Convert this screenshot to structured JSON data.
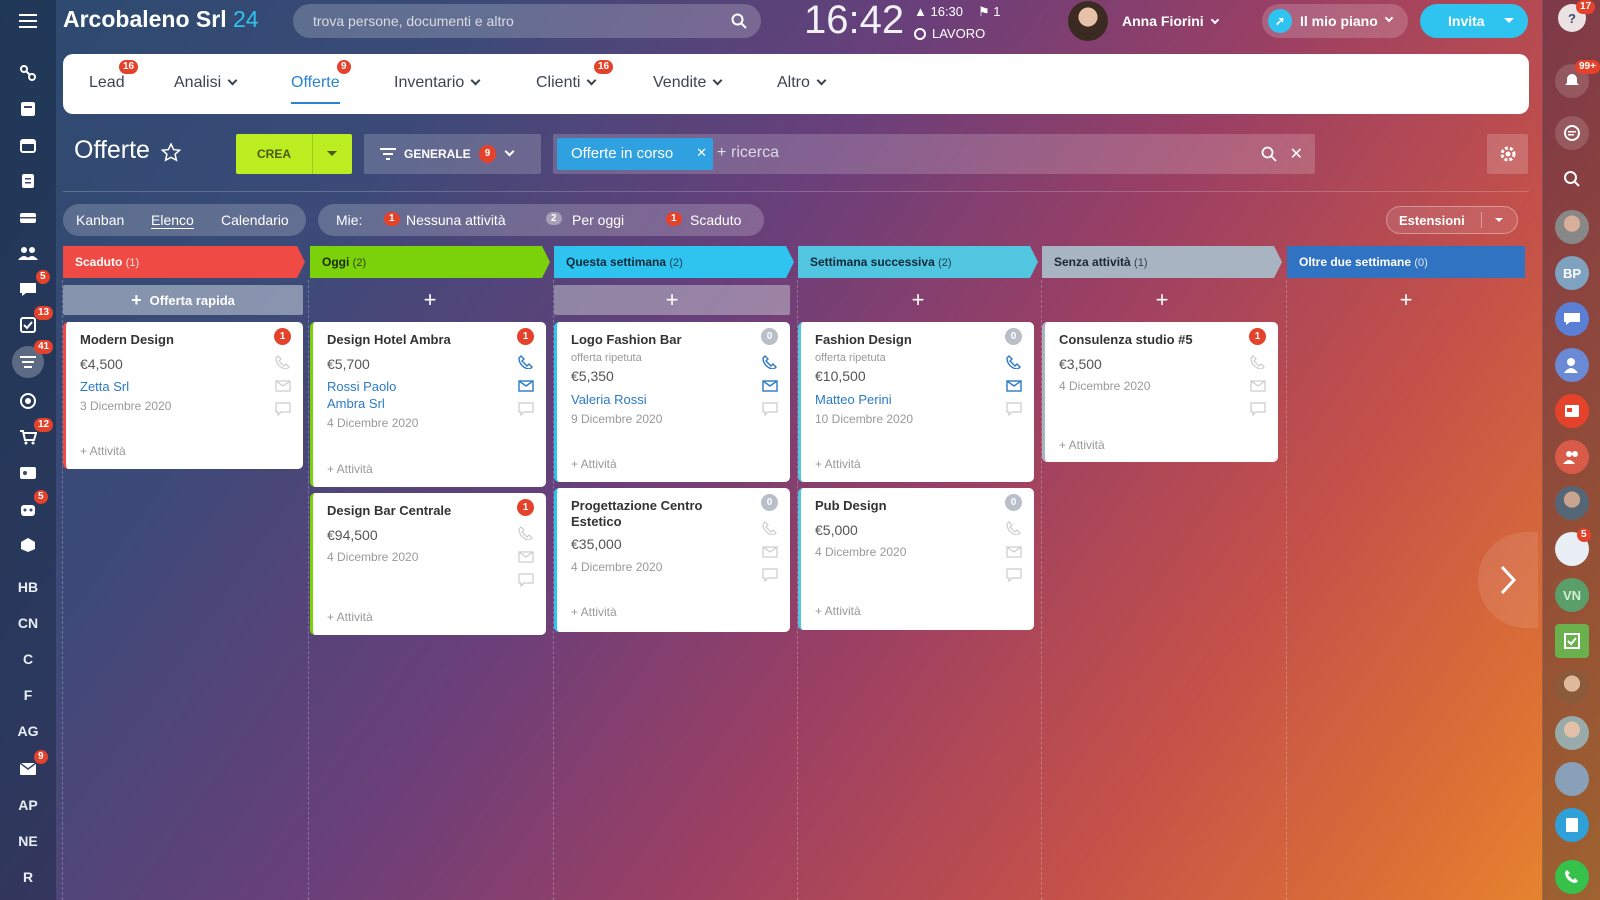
{
  "app": {
    "brand": "Arcobaleno Srl",
    "brand_num": "24",
    "search_placeholder": "trova persone, documenti e altro",
    "clock": "16:42",
    "alarm": "16:30",
    "flag_count": "1",
    "work_status": "LAVORO",
    "user_name": "Anna Fiorini",
    "plan_label": "Il mio piano",
    "invite_label": "Invita",
    "help_badge": "17"
  },
  "left_sidebar": {
    "badges": {
      "chat": "5",
      "tasks": "13",
      "crm": "41",
      "shop": "12",
      "robot": "5",
      "mail": "9"
    },
    "letters": [
      "HB",
      "CN",
      "C",
      "F",
      "AG",
      "AP",
      "NE",
      "R"
    ]
  },
  "menu": [
    {
      "label": "Lead",
      "badge": "16"
    },
    {
      "label": "Analisi"
    },
    {
      "label": "Offerte",
      "badge": "9"
    },
    {
      "label": "Inventario"
    },
    {
      "label": "Clienti",
      "badge": "16"
    },
    {
      "label": "Vendite"
    },
    {
      "label": "Altro"
    }
  ],
  "toolbar": {
    "title": "Offerte",
    "create_label": "CREA",
    "filter_label": "GENERALE",
    "filter_count": "9",
    "filter_tag": "Offerte in corso",
    "search_prefix": "+",
    "search_placeholder": "ricerca"
  },
  "views": {
    "kanban": "Kanban",
    "list": "Elenco",
    "calendar": "Calendario"
  },
  "mine": {
    "label": "Mie:",
    "none_count": "1",
    "none_label": "Nessuna attività",
    "today_count": "2",
    "today_label": "Per oggi",
    "overdue_count": "1",
    "overdue_label": "Scaduto"
  },
  "extensions_label": "Estensioni",
  "columns": [
    {
      "title": "Scaduto",
      "count": "(1)",
      "color": "#ef4a44",
      "quick": "Offerta rapida"
    },
    {
      "title": "Oggi",
      "count": "(2)",
      "color": "#7bd10a"
    },
    {
      "title": "Questa settimana",
      "count": "(2)",
      "color": "#2fc4f0"
    },
    {
      "title": "Settimana successiva",
      "count": "(2)",
      "color": "#52c5e0"
    },
    {
      "title": "Senza attività",
      "count": "(1)",
      "color": "#a8b4c2"
    },
    {
      "title": "Oltre due settimane",
      "count": "(0)",
      "color": "#2f73c2"
    }
  ],
  "plus": "+",
  "add_activity": "+ Attività",
  "cards": [
    {
      "title": "Modern Design",
      "price": "€4,500",
      "link1": "Zetta Srl",
      "date": "3 Dicembre 2020",
      "count": "1"
    },
    {
      "title": "Design Hotel Ambra",
      "price": "€5,700",
      "link1": "Rossi Paolo",
      "link2": "Ambra Srl",
      "date": "4 Dicembre 2020",
      "count": "1"
    },
    {
      "title": "Design Bar Centrale",
      "price": "€94,500",
      "date": "4 Dicembre 2020",
      "count": "1"
    },
    {
      "title": "Logo Fashion Bar",
      "sub": "offerta ripetuta",
      "price": "€5,350",
      "link1": "Valeria Rossi",
      "date": "9 Dicembre 2020",
      "count": "0"
    },
    {
      "title": "Progettazione Centro",
      "title2": "Estetico",
      "price": "€35,000",
      "date": "4 Dicembre 2020",
      "count": "0"
    },
    {
      "title": "Fashion Design",
      "sub": "offerta ripetuta",
      "price": "€10,500",
      "link1": "Matteo Perini",
      "date": "10 Dicembre 2020",
      "count": "0"
    },
    {
      "title": "Pub Design",
      "price": "€5,000",
      "date": "4 Dicembre 2020",
      "count": "0"
    },
    {
      "title": "Consulenza studio #5",
      "price": "€3,500",
      "date": "4 Dicembre 2020",
      "count": "1"
    }
  ],
  "right_sidebar": {
    "notif_badge": "99+",
    "bp": "BP",
    "vn": "VN",
    "group_badge": "5"
  }
}
